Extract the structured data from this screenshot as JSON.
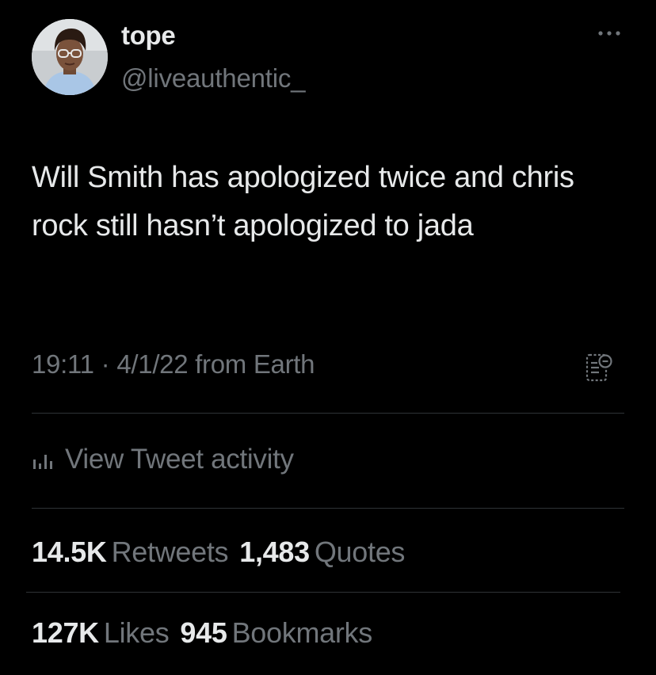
{
  "author": {
    "display_name": "tope",
    "handle": "@liveauthentic_"
  },
  "tweet": {
    "text": "Will Smith has apologized twice and chris rock still hasn’t apologized to jada",
    "time": "19:11",
    "separator": "·",
    "date": "4/1/22",
    "source": "from Earth"
  },
  "activity": {
    "label": "View Tweet activity",
    "icon": "bar-chart-icon"
  },
  "stats": {
    "retweets_count": "14.5K",
    "retweets_label": "Retweets",
    "quotes_count": "1,483",
    "quotes_label": "Quotes",
    "likes_count": "127K",
    "likes_label": "Likes",
    "bookmarks_count": "945",
    "bookmarks_label": "Bookmarks"
  },
  "icons": {
    "more": "more-horizontal-icon",
    "community_notes": "community-notes-icon"
  },
  "colors": {
    "background": "#000000",
    "primary_text": "#e7e9ea",
    "secondary_text": "#71767b",
    "divider": "#2f3336"
  }
}
